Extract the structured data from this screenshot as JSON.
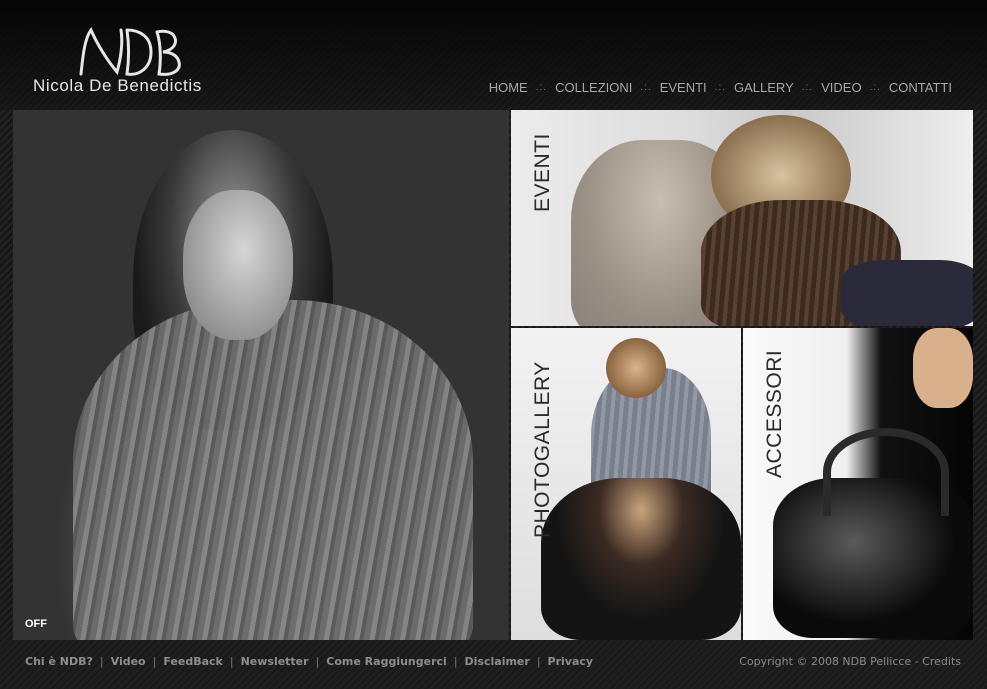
{
  "brand": {
    "monogram": "NDB",
    "name": "Nicola De Benedictis"
  },
  "nav": {
    "items": [
      "HOME",
      "COLLEZIONI",
      "EVENTI",
      "GALLERY",
      "VIDEO",
      "CONTATTI"
    ],
    "separator": ".:."
  },
  "hero": {
    "sound_toggle": "OFF"
  },
  "tiles": {
    "eventi": "EVENTI",
    "photogallery": "PHOTOGALLERY",
    "accessori": "ACCESSORI"
  },
  "footer": {
    "links": [
      "Chi è NDB?",
      "Video",
      "FeedBack",
      "Newsletter",
      "Come Raggiungerci",
      "Disclaimer",
      "Privacy"
    ],
    "separator": "|",
    "copyright": "Copyright © 2008 NDB Pellicce - Credits"
  },
  "colors": {
    "background": "#1c1c1c",
    "nav_text": "#a8a8a8",
    "footer_text": "#8e8e8e"
  }
}
